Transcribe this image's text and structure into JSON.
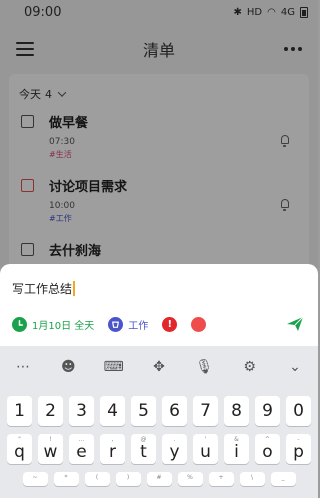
{
  "status_bar": {
    "time": "09:00",
    "icons": [
      "bluetooth-icon",
      "hd-icon",
      "wifi-icon",
      "4g-signal-icon",
      "battery-icon"
    ],
    "hd_label": "HD",
    "net_label": "4G"
  },
  "header": {
    "title": "清单"
  },
  "list": {
    "section_label": "今天",
    "section_count": "4",
    "tasks": [
      {
        "title": "做早餐",
        "time": "07:30",
        "tag": "#生活",
        "tag_color": "#d94c7c",
        "checkbox_color": "#555555"
      },
      {
        "title": "讨论项目需求",
        "time": "10:00",
        "tag": "#工作",
        "tag_color": "#4b55c9",
        "checkbox_color": "#e25050"
      },
      {
        "title": "去什刹海",
        "time": "",
        "tag": "",
        "checkbox_color": "#555555"
      }
    ]
  },
  "composer": {
    "input_value": "写工作总结",
    "date_chip": "1月10日 全天",
    "date_color": "#19a24b",
    "list_chip": "工作",
    "list_color": "#4b55c9",
    "priority_color": "#e3262b",
    "priority_symbol": "!",
    "color_dot": "#ef4c4c",
    "send_color": "#19a24b"
  },
  "keyboard": {
    "toolbar_icons": [
      "more-icon",
      "emoji-icon",
      "keyboard-icon",
      "cursor-move-icon",
      "microphone-icon",
      "settings-icon",
      "collapse-icon"
    ],
    "number_row": [
      "1",
      "2",
      "3",
      "4",
      "5",
      "6",
      "7",
      "8",
      "9",
      "0"
    ],
    "qwerty_row": [
      {
        "key": "q",
        "sub": "\""
      },
      {
        "key": "w",
        "sub": "!"
      },
      {
        "key": "e",
        "sub": "…"
      },
      {
        "key": "r",
        "sub": ","
      },
      {
        "key": "t",
        "sub": "@"
      },
      {
        "key": "y",
        "sub": "."
      },
      {
        "key": "u",
        "sub": "'"
      },
      {
        "key": "i",
        "sub": "&"
      },
      {
        "key": "o",
        "sub": "^"
      },
      {
        "key": "p",
        "sub": "-"
      }
    ],
    "partial_row": [
      {
        "sub": "~"
      },
      {
        "sub": "*"
      },
      {
        "sub": "("
      },
      {
        "sub": ")"
      },
      {
        "sub": "#"
      },
      {
        "sub": "%"
      },
      {
        "sub": "+"
      },
      {
        "sub": "\\"
      },
      {
        "sub": "_"
      }
    ]
  }
}
